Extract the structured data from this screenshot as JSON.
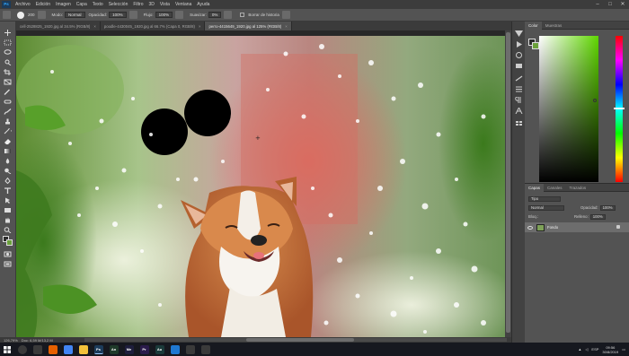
{
  "menubar": {
    "logo": "Ps",
    "items": [
      "Archivo",
      "Edición",
      "Imagen",
      "Capa",
      "Texto",
      "Selección",
      "Filtro",
      "3D",
      "Vista",
      "Ventana",
      "Ayuda"
    ]
  },
  "options": {
    "brush_size": "200",
    "mode_label": "Modo:",
    "mode_value": "Normal",
    "opacity_label": "Opacidad:",
    "opacity_value": "100%",
    "flow_label": "Flujo:",
    "flow_value": "100%",
    "smoothing_label": "Suavizar:",
    "smoothing_value": "0%",
    "erase_history_label": "Borrar de historia"
  },
  "tabs": [
    {
      "label": "cell-2528825_1920.jpg al 34.5% (RGB/8)",
      "active": false
    },
    {
      "label": "poodle-4430045_1920.jpg al 66.7% (Capa 0, RGB/8)",
      "active": false
    },
    {
      "label": "perro-4415649_1920.jpg al 125% (RGB/8)",
      "active": true
    }
  ],
  "status": {
    "zoom": "126,79%",
    "doc": "Doc: 6,59 M/13,2 M"
  },
  "color_panel": {
    "tabs": [
      "Color",
      "Muestras"
    ],
    "foreground": "#2b2b2b",
    "background": "#6aa03a"
  },
  "layers_panel": {
    "tabs": [
      "Capas",
      "Canales",
      "Trazados"
    ],
    "kind_label": "Tipo",
    "blend_mode": "Normal",
    "opacity_label": "Opacidad:",
    "opacity_value": "100%",
    "lock_label": "Bloq.:",
    "fill_label": "Relleno:",
    "fill_value": "100%",
    "layer_name": "Fondo"
  },
  "taskbar": {
    "apps": [
      {
        "name": "firefox",
        "color": "#e66000",
        "label": ""
      },
      {
        "name": "chrome",
        "color": "#4285f4",
        "label": ""
      },
      {
        "name": "explorer",
        "color": "#f3c13a",
        "label": ""
      },
      {
        "name": "photoshop",
        "color": "#1c3b5a",
        "label": "Ps"
      },
      {
        "name": "animate",
        "color": "#1f3a2a",
        "label": "An"
      },
      {
        "name": "media-encoder",
        "color": "#1e1e3c",
        "label": "Me"
      },
      {
        "name": "premiere",
        "color": "#2a1b4a",
        "label": "Pr"
      },
      {
        "name": "audition",
        "color": "#1b3a3a",
        "label": "Au"
      },
      {
        "name": "vscode",
        "color": "#1f78d1",
        "label": ""
      },
      {
        "name": "store",
        "color": "#3a3a3a",
        "label": ""
      },
      {
        "name": "settings",
        "color": "#3a3a3a",
        "label": ""
      }
    ],
    "lang": "ESP",
    "time": "09:56",
    "date": "30/8/2019"
  }
}
